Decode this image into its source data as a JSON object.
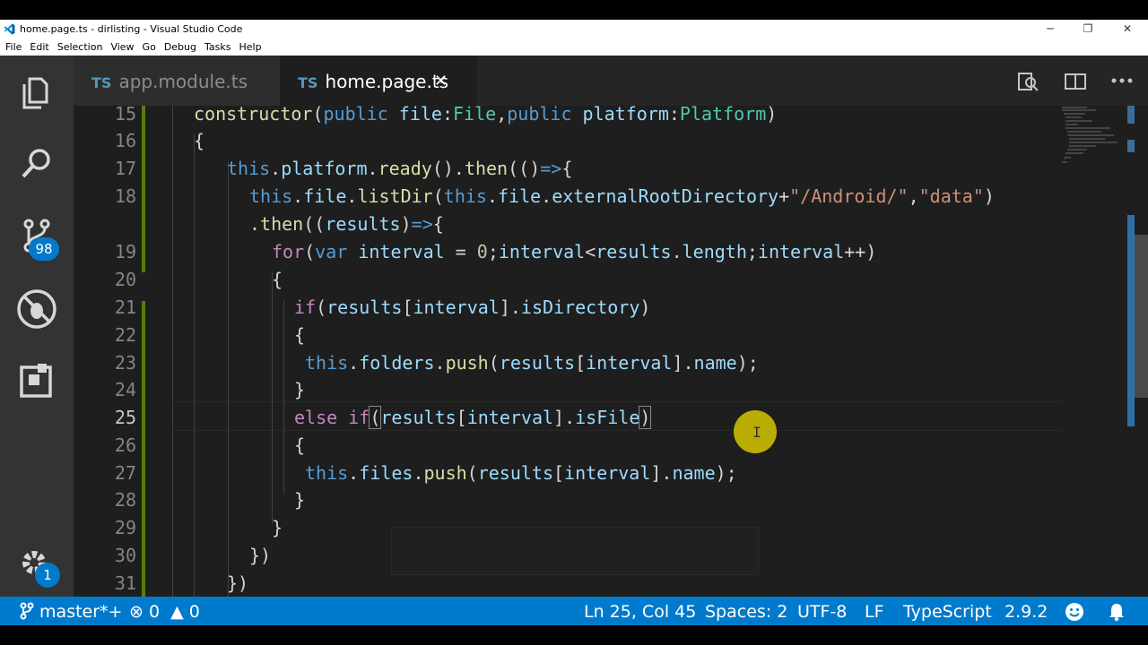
{
  "window": {
    "title": "home.page.ts - dirlisting - Visual Studio Code"
  },
  "menu": [
    "File",
    "Edit",
    "Selection",
    "View",
    "Go",
    "Debug",
    "Tasks",
    "Help"
  ],
  "activity": {
    "scm_badge": "98",
    "settings_badge": "1"
  },
  "tabs": [
    {
      "lang": "TS",
      "label": "app.module.ts",
      "active": false
    },
    {
      "lang": "TS",
      "label": "home.page.ts",
      "active": true,
      "close": "✕"
    }
  ],
  "editor": {
    "lines": [
      "15",
      "16",
      "17",
      "18",
      "",
      "19",
      "20",
      "21",
      "22",
      "23",
      "24",
      "25",
      "26",
      "27",
      "28",
      "29",
      "30",
      "31"
    ],
    "current_line": "25"
  },
  "status": {
    "branch": "master*+",
    "errors": "0",
    "warnings": "0",
    "position": "Ln 25, Col 45",
    "spaces": "Spaces: 2",
    "encoding": "UTF-8",
    "eol": "LF",
    "language": "TypeScript",
    "version": "2.9.2"
  },
  "colors": {
    "accent": "#007acc",
    "activity_bar": "#333333",
    "editor_bg": "#1e1e1e",
    "cursor_highlight": "#d4c400"
  }
}
